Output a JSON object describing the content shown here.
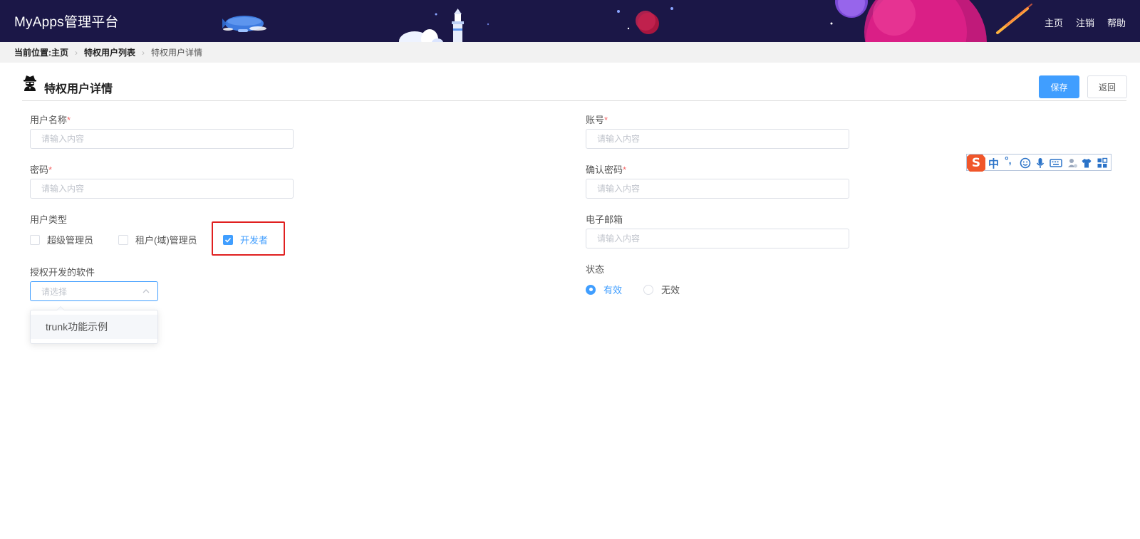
{
  "header": {
    "app_title": "MyApps管理平台",
    "nav": [
      "主页",
      "注销",
      "帮助"
    ]
  },
  "breadcrumb": {
    "prefix": "当前位置:",
    "items": [
      "主页",
      "特权用户列表",
      "特权用户详情"
    ]
  },
  "page": {
    "title": "特权用户详情",
    "save_label": "保存",
    "back_label": "返回"
  },
  "form": {
    "username": {
      "label": "用户名称",
      "required_mark": "*",
      "placeholder": "请输入内容",
      "value": ""
    },
    "account": {
      "label": "账号",
      "required_mark": "*",
      "placeholder": "请输入内容",
      "value": ""
    },
    "password": {
      "label": "密码",
      "required_mark": "*",
      "placeholder": "请输入内容",
      "value": ""
    },
    "confirm_password": {
      "label": "确认密码",
      "required_mark": "*",
      "placeholder": "请输入内容",
      "value": ""
    },
    "user_type": {
      "label": "用户类型",
      "options": [
        {
          "label": "超级管理员",
          "checked": false
        },
        {
          "label": "租户(域)管理员",
          "checked": false
        },
        {
          "label": "开发者",
          "checked": true
        }
      ]
    },
    "email": {
      "label": "电子邮箱",
      "placeholder": "请输入内容",
      "value": ""
    },
    "authorized_software": {
      "label": "授权开发的软件",
      "placeholder": "请选择",
      "dropdown_options": [
        "trunk功能示例"
      ]
    },
    "status": {
      "label": "状态",
      "options": [
        {
          "label": "有效",
          "checked": true
        },
        {
          "label": "无效",
          "checked": false
        }
      ]
    }
  },
  "ime_toolbar": {
    "mode_label": "中",
    "punct_label": "°,"
  },
  "colors": {
    "header_bg": "#1b1747",
    "primary": "#409eff",
    "required": "#f56c6c",
    "highlight_border": "#e02020"
  }
}
